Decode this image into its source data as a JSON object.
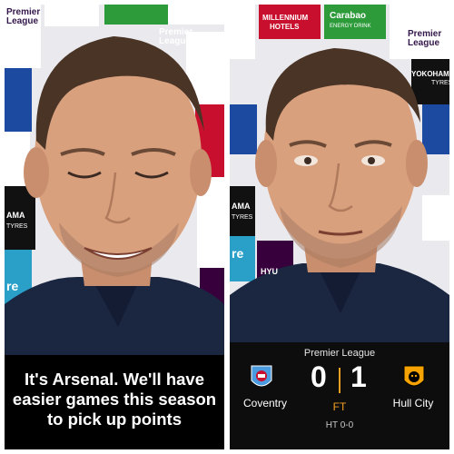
{
  "left_panel": {
    "caption_lines": [
      "It's Arsenal. We'll have",
      "easier games this season",
      "to pick up points"
    ],
    "board_texts": [
      "Premier",
      "League",
      "Premier",
      "League",
      "AMA",
      "TYRES",
      "re"
    ]
  },
  "right_panel": {
    "board_texts": [
      "MILLENNIUM",
      "HOTELS",
      "Carabao",
      "ENERGY DRINK",
      "Premier",
      "League",
      "YOKOHAMA",
      "TYRES",
      "AMA",
      "TYRES",
      "re",
      "HYU"
    ],
    "scorecard": {
      "competition": "Premier League",
      "home_team": "Coventry",
      "away_team": "Hull City",
      "home_score": "0",
      "away_score": "1",
      "status": "FT",
      "half_time": "HT 0-0",
      "status_color": "#f0a020"
    }
  },
  "colors": {
    "caption_bg": "#000000",
    "scorecard_bg": "#0d0d0d",
    "board_purple": "#37003c",
    "board_red": "#c8102e",
    "board_blue": "#1c4aa0",
    "jacket_navy": "#1b2640",
    "mic_cyan": "#2ab9d6"
  }
}
